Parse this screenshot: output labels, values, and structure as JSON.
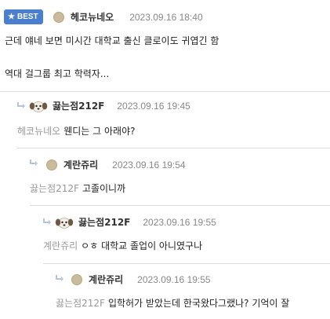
{
  "best_badge": {
    "label": "BEST"
  },
  "post": {
    "author": "헤코뉴네오",
    "date": "2023.09.16 18:40",
    "line1": "근데 얘네 보면 미시간 대학교 출신 클로이도 귀엽긴 함",
    "line2": "역대 걸그룹 최고 학력자..."
  },
  "replies": [
    {
      "author": "끓는점212F",
      "date": "2023.09.16 19:45",
      "mention": "헤코뉴네오",
      "text": "웬디는 그 아래야?"
    },
    {
      "author": "계란쥬리",
      "date": "2023.09.16 19:54",
      "mention": "끓는점212F",
      "text": "고졸이니까"
    },
    {
      "author": "끓는점212F",
      "date": "2023.09.16 19:55",
      "mention": "계란쥬리",
      "text": "ㅇㅎ 대학교 졸업이 아니였구나"
    },
    {
      "author": "계란쥬리",
      "date": "2023.09.16 19:55",
      "mention": "끓는점212F",
      "text": "입학허가 받았는데 한국왔다그랬나? 기억이 잘"
    }
  ],
  "colors": {
    "badge": "#4a7fd0",
    "mention": "#999999",
    "date": "#888888",
    "separator": "#dddddd"
  },
  "icons": {
    "badge": "star-icon",
    "reply": "reply-arrow-icon",
    "avatar_a": "dog-avatar-icon",
    "avatar_b": "round-avatar-icon"
  }
}
